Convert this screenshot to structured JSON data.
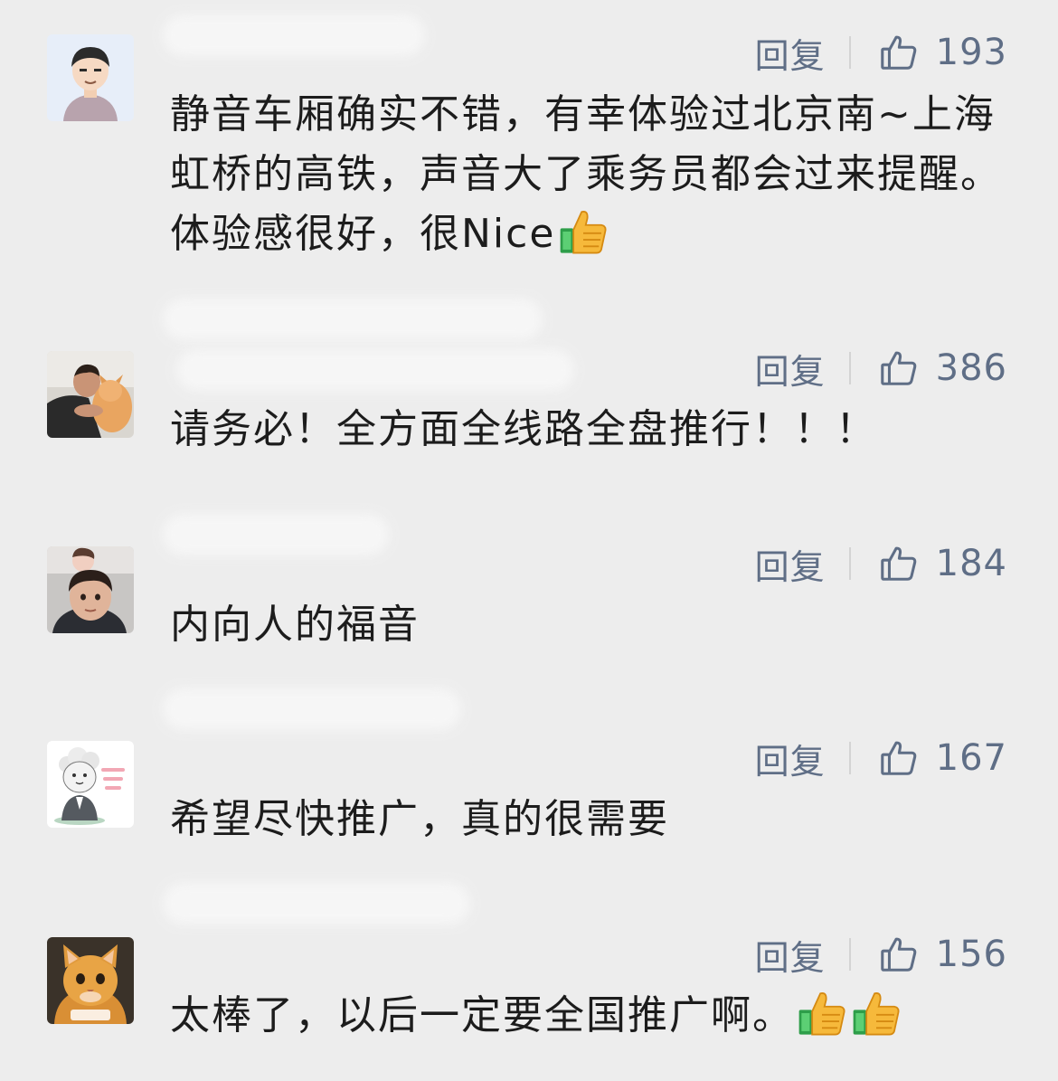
{
  "comments": [
    {
      "reply_label": "回复",
      "like_count": "193",
      "text": "静音车厢确实不错，有幸体验过北京南~上海虹桥的高铁，声音大了乘务员都会过来提醒。体验感很好，很Nice",
      "emoji_count": 1,
      "avatar_icon": "cartoon-man-avatar"
    },
    {
      "reply_label": "回复",
      "like_count": "386",
      "text": "请务必！全方面全线路全盘推行！！！",
      "emoji_count": 0,
      "avatar_icon": "man-with-cat-avatar"
    },
    {
      "reply_label": "回复",
      "like_count": "184",
      "text": "内向人的福音",
      "emoji_count": 0,
      "avatar_icon": "selfie-avatar"
    },
    {
      "reply_label": "回复",
      "like_count": "167",
      "text": "希望尽快推广，真的很需要",
      "emoji_count": 0,
      "avatar_icon": "cartoon-sheep-avatar"
    },
    {
      "reply_label": "回复",
      "like_count": "156",
      "text": "太棒了，以后一定要全国推广啊。",
      "emoji_count": 2,
      "avatar_icon": "orange-cat-avatar"
    }
  ],
  "colors": {
    "background": "#ededed",
    "action_text": "#5f6e86",
    "content_text": "#1c1c1c"
  },
  "icons": {
    "like": "thumbs-up-outline-icon",
    "emoji": "thumbs-up-emoji-icon"
  }
}
